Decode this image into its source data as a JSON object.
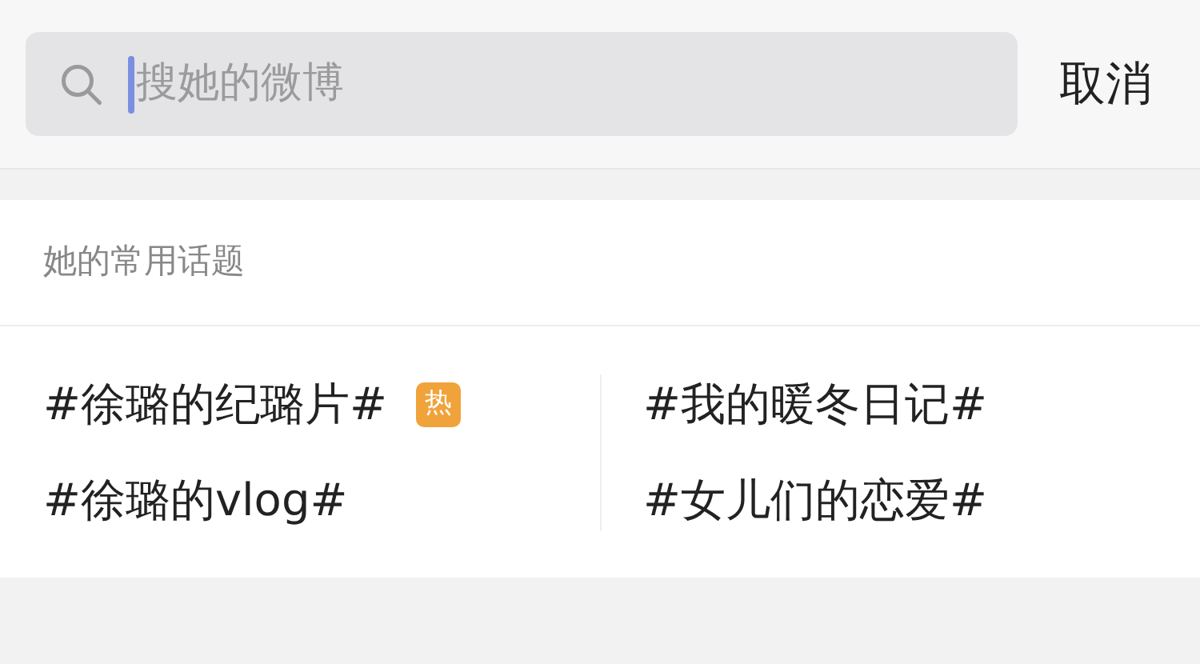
{
  "search": {
    "placeholder": "搜她的微博",
    "cancel": "取消"
  },
  "topics": {
    "title": "她的常用话题",
    "columns": [
      [
        {
          "text": "#徐璐的纪璐片#",
          "badge": "热"
        },
        {
          "text": "#徐璐的vlog#"
        }
      ],
      [
        {
          "text": "#我的暖冬日记#"
        },
        {
          "text": "#女儿们的恋爱#"
        }
      ]
    ]
  }
}
